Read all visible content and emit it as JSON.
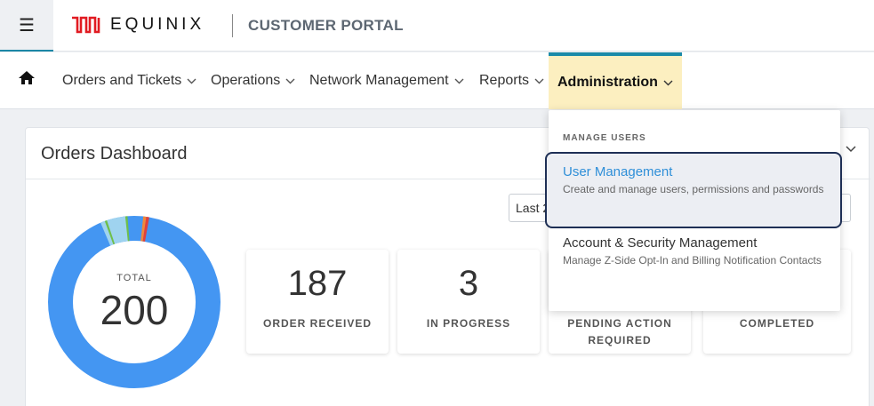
{
  "header": {
    "logo_text": "EQUINIX",
    "portal_title": "CUSTOMER PORTAL"
  },
  "icons": {
    "menu": "hamburger-menu-icon",
    "home": "home-icon",
    "chevron": "chevron-down-icon"
  },
  "nav": {
    "items": [
      {
        "label": "Orders and Tickets"
      },
      {
        "label": "Operations"
      },
      {
        "label": "Network Management"
      },
      {
        "label": "Reports"
      },
      {
        "label": "Administration",
        "active": true
      }
    ]
  },
  "dashboard": {
    "title": "Orders Dashboard",
    "range_select_value": "Last 2",
    "total_label": "TOTAL",
    "total_value": "200",
    "cards": [
      {
        "value": "187",
        "label": "ORDER RECEIVED"
      },
      {
        "value": "3",
        "label": "IN PROGRESS"
      },
      {
        "value": "",
        "label": "PENDING ACTION REQUIRED"
      },
      {
        "value": "",
        "label": "COMPLETED"
      }
    ]
  },
  "dropdown": {
    "heading": "MANAGE USERS",
    "items": [
      {
        "title": "User Management",
        "description": "Create and manage users, permissions and passwords"
      },
      {
        "title": "Account & Security Management",
        "description": "Manage Z-Side Opt-In and Billing Notification Contacts"
      }
    ]
  },
  "colors": {
    "accent": "#1b8aa8",
    "active_nav_bg": "#fcefc0",
    "link": "#2f8fd8",
    "donut_main": "#4496f2",
    "donut_light": "#9fd3ef",
    "donut_green": "#6fbf4a",
    "donut_orange": "#f0883a",
    "donut_red": "#e0413b"
  }
}
